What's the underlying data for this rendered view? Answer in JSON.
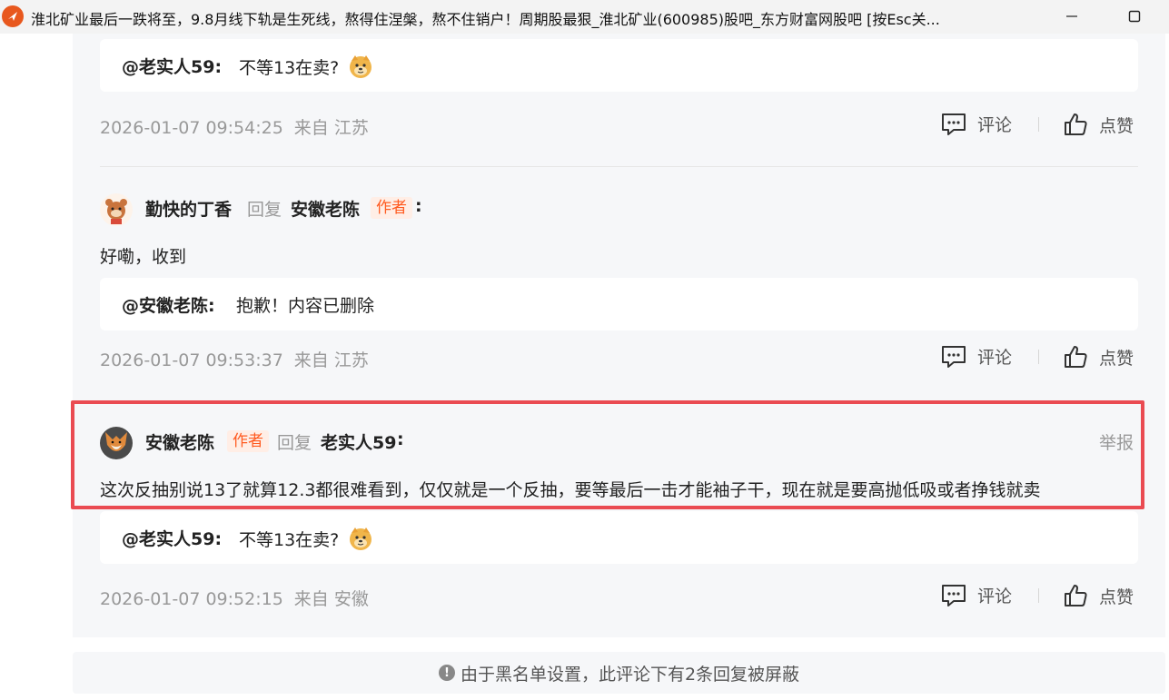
{
  "window": {
    "title": "淮北矿业最后一跌将至，9.8月线下轨是生死线，熬得住涅槃，熬不住销户！周期股最狠_淮北矿业(600985)股吧_东方财富网股吧    [按Esc关..."
  },
  "actions": {
    "comment_label": "评论",
    "like_label": "点赞",
    "report_label": "举报"
  },
  "thread": [
    {
      "quote_name": "@老实人59:",
      "quote_text": "不等13在卖?",
      "time": "2026-01-07 09:54:25",
      "location": "来自 江苏"
    },
    {
      "author": "勤快的丁香",
      "reply_word": "回复",
      "target": "安徽老陈",
      "target_badge": "作者",
      "colon": ":",
      "text": "好嘞，收到",
      "quote_name": "@安徽老陈:",
      "quote_text": "抱歉！内容已删除",
      "time": "2026-01-07 09:53:37",
      "location": "来自 江苏"
    },
    {
      "author": "安徽老陈",
      "author_badge": "作者",
      "reply_word": "回复",
      "target": "老实人59",
      "colon": ":",
      "text": "这次反抽别说13了就算12.3都很难看到，仅仅就是一个反抽，要等最后一击才能袖子干，现在就是要高抛低吸或者挣钱就卖",
      "quote_name": "@老实人59:",
      "quote_text": "不等13在卖?",
      "time": "2026-01-07 09:52:15",
      "location": "来自 安徽"
    }
  ],
  "blacklist_notice": "由于黑名单设置，此评论下有2条回复被屏蔽",
  "icons": {
    "app": "eastmoney-logo-icon",
    "minimize": "minimize-icon",
    "maximize": "maximize-icon",
    "comment": "comment-icon",
    "like": "thumbs-up-icon",
    "emoji": "doge-emoji-icon",
    "info": "info-icon"
  },
  "colors": {
    "highlight_border": "#ea4b52",
    "author_badge": "#ff5a1f",
    "panel_bg": "#f6f7f9"
  }
}
